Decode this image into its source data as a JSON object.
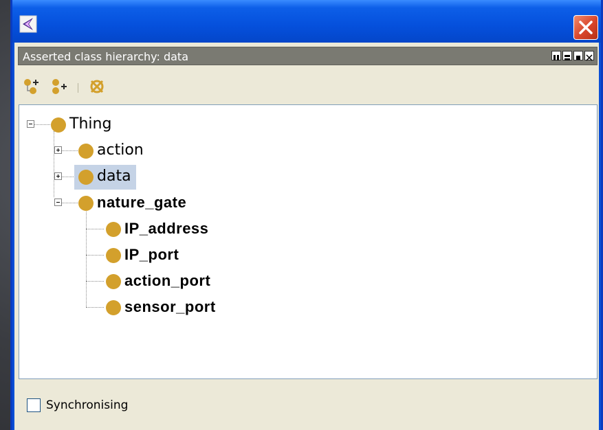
{
  "window": {
    "app_icon": "protege-icon",
    "close_icon": "close-icon"
  },
  "view": {
    "title": "Asserted class hierarchy: data",
    "controls": [
      "maximize-view-icon",
      "minimize-view-icon",
      "restore-view-icon",
      "close-view-icon"
    ]
  },
  "toolbar": {
    "buttons": [
      {
        "icon": "add-subclass-icon"
      },
      {
        "icon": "add-sibling-class-icon"
      },
      {
        "icon": "delete-class-icon"
      }
    ]
  },
  "tree": {
    "root": "Thing",
    "children": [
      {
        "label": "action",
        "expanded": false,
        "bold": false
      },
      {
        "label": "data",
        "expanded": false,
        "bold": false,
        "selected": true
      },
      {
        "label": "nature_gate",
        "expanded": true,
        "bold": true,
        "children": [
          "IP_address",
          "IP_port",
          "action_port",
          "sensor_port"
        ]
      }
    ]
  },
  "status": {
    "sync_label": "Synchronising",
    "sync_checked": false
  },
  "colors": {
    "class_dot": "#d3a02c",
    "titlebar": "#0550dc",
    "selection": "#c5d3e6"
  }
}
